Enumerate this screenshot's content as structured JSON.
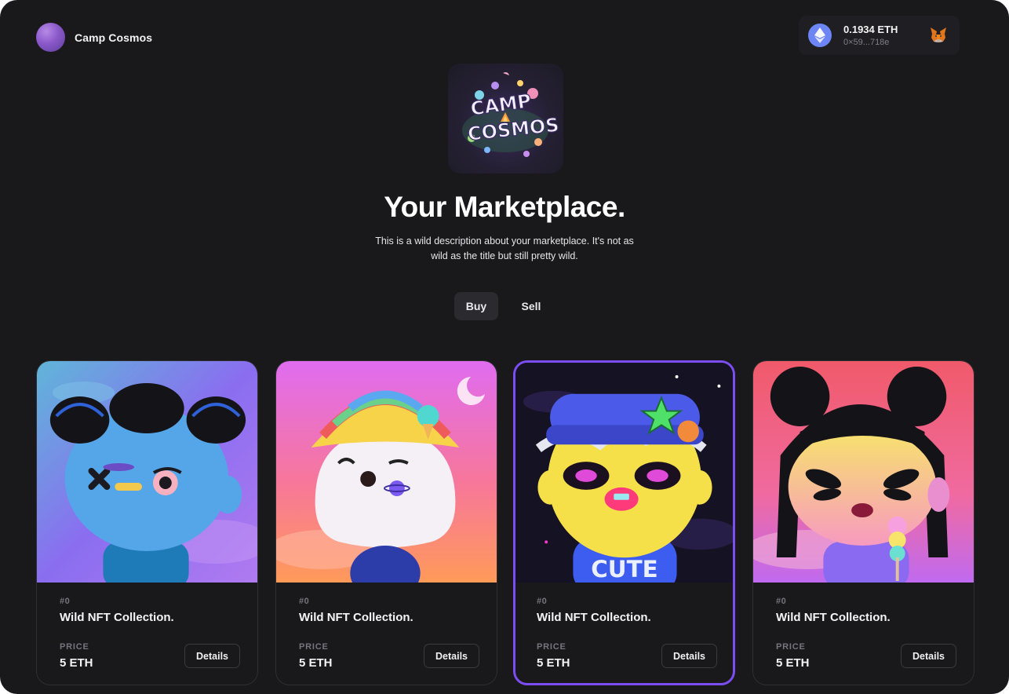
{
  "header": {
    "brand_name": "Camp Cosmos",
    "wallet": {
      "balance": "0.1934 ETH",
      "address": "0×59...718e"
    }
  },
  "hero": {
    "logo_text": "CAMP COSMOS",
    "title": "Your Marketplace.",
    "description": "This is a wild description about your marketplace. It's not as wild as the title but still pretty wild."
  },
  "tabs": [
    {
      "label": "Buy",
      "active": true
    },
    {
      "label": "Sell",
      "active": false
    }
  ],
  "cards": [
    {
      "id": "#0",
      "name": "Wild NFT Collection.",
      "price_label": "PRICE",
      "price": "5 ETH",
      "button": "Details",
      "art": "blue-character-with-buns"
    },
    {
      "id": "#0",
      "name": "Wild NFT Collection.",
      "price_label": "PRICE",
      "price": "5 ETH",
      "button": "Details",
      "art": "ghost-with-rainbow-hat"
    },
    {
      "id": "#0",
      "name": "Wild NFT Collection.",
      "price_label": "PRICE",
      "price": "5 ETH",
      "button": "Details",
      "art": "yellow-character-cute-shirt",
      "artwork_text": "CUTE"
    },
    {
      "id": "#0",
      "name": "Wild NFT Collection.",
      "price_label": "PRICE",
      "price": "5 ETH",
      "button": "Details",
      "art": "girl-with-buns-and-icecream"
    }
  ],
  "colors": {
    "background": "#19191c",
    "accent": "#7b4df2",
    "eth": "#6e85f5"
  }
}
